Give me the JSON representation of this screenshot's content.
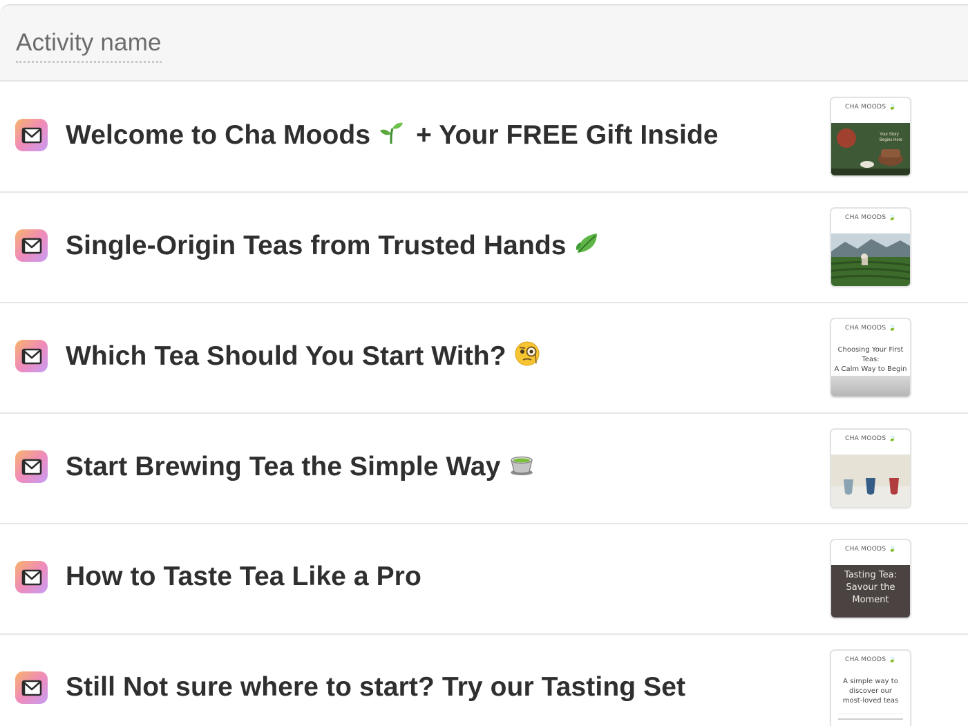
{
  "header": {
    "column_label": "Activity name"
  },
  "activities": [
    {
      "title": "Welcome to Cha Moods",
      "emoji": "🌱",
      "title_suffix": "+ Your FREE Gift Inside",
      "icon": "mail-icon",
      "thumbnail": {
        "brand": "CHA MOODS",
        "type": "photo-tea-pour"
      }
    },
    {
      "title": "Single-Origin Teas from Trusted Hands",
      "emoji": "🍃",
      "icon": "mail-icon",
      "thumbnail": {
        "brand": "CHA MOODS",
        "type": "photo-tea-field"
      }
    },
    {
      "title": "Which Tea Should You Start With?",
      "emoji": "🧐",
      "icon": "mail-icon",
      "thumbnail": {
        "brand": "CHA MOODS",
        "type": "text",
        "lines": [
          "Choosing Your First",
          "Teas:",
          "A Calm Way to Begin"
        ]
      }
    },
    {
      "title": "Start Brewing Tea the Simple Way",
      "emoji": "🍵",
      "icon": "mail-icon",
      "thumbnail": {
        "brand": "CHA MOODS",
        "type": "photo-cups"
      }
    },
    {
      "title": "How to Taste Tea Like a Pro",
      "emoji": "",
      "icon": "mail-icon",
      "thumbnail": {
        "brand": "CHA MOODS",
        "type": "dark-text",
        "lines": [
          "Tasting Tea:",
          "Savour the",
          "Moment"
        ]
      }
    },
    {
      "title": "Still Not sure where to start? Try our Tasting Set",
      "emoji": "",
      "icon": "mail-icon",
      "thumbnail": {
        "brand": "CHA MOODS",
        "type": "text",
        "lines": [
          "A simple way to",
          "discover our",
          "most-loved teas"
        ]
      }
    }
  ],
  "colors": {
    "badge_gradient": [
      "#f7b36b",
      "#f08bb9",
      "#c79cf4"
    ],
    "title_text": "#2f2f2f",
    "header_bg": "#f6f6f6"
  }
}
